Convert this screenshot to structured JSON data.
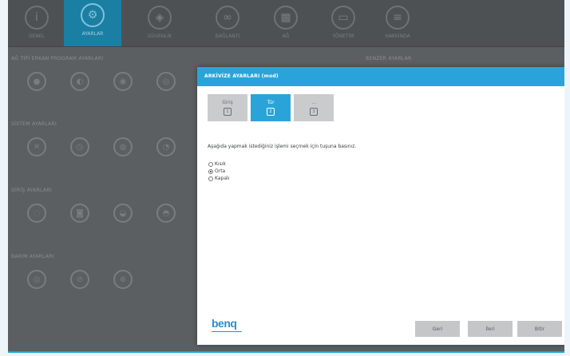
{
  "toolbar": {
    "items": [
      {
        "label": "GENEL",
        "icon": "info-icon"
      },
      {
        "label": "AYARLAR",
        "icon": "settings-icon",
        "active": true
      },
      {
        "label": "GÜVENLİK",
        "icon": "shield-icon"
      },
      {
        "label": "BAĞLANTI",
        "icon": "link-icon"
      },
      {
        "label": "AĞ",
        "icon": "network-icon"
      },
      {
        "label": "YÖNETİM",
        "icon": "manage-icon"
      },
      {
        "label": "HAKKINDA",
        "icon": "about-icon"
      }
    ]
  },
  "background": {
    "sections": [
      {
        "title": "AĞ TİPİ ERKAN PROGRAM AYARLARI",
        "icons": [
          "",
          "",
          "",
          ""
        ]
      },
      {
        "title": "SİSTEM AYARLARI",
        "icons": [
          "",
          "",
          "",
          ""
        ]
      },
      {
        "title": "GİRİŞ AYARLARI",
        "icons": [
          "",
          "",
          "",
          ""
        ]
      },
      {
        "title": "BAKIM AYARLARI",
        "icons": [
          "",
          "",
          ""
        ]
      }
    ],
    "right_title": "BENZER AYARLAR"
  },
  "modal": {
    "title": "ARKİVİZE AYARLARI (mod)",
    "steps": [
      {
        "label": "Giriş",
        "glyph": "1"
      },
      {
        "label": "Tür",
        "glyph": "2",
        "active": true
      },
      {
        "label": "...",
        "glyph": "3"
      }
    ],
    "prompt": "Aşağıda yapmak istediğiniz işlemi seçmek için tuşuna basınız.",
    "options": [
      {
        "label": "Kısık",
        "selected": false
      },
      {
        "label": "Orta",
        "selected": true
      },
      {
        "label": "Kapalı",
        "selected": false
      }
    ],
    "logo": "benq",
    "buttons": {
      "back": "Geri",
      "next": "İleri",
      "done": "Bitir"
    }
  }
}
